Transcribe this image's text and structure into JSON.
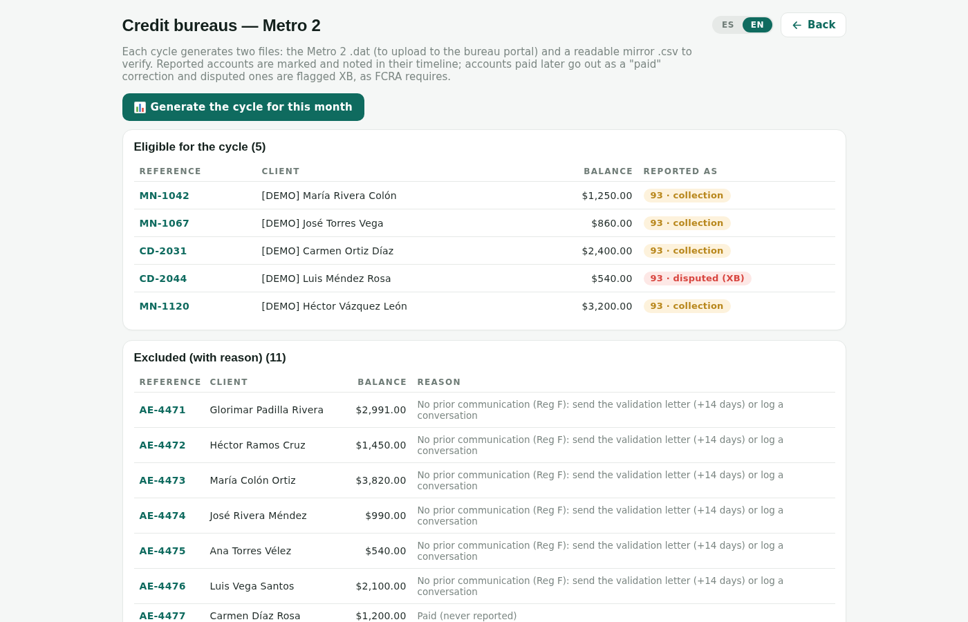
{
  "header": {
    "title": "Credit bureaus — Metro 2",
    "languages": [
      {
        "label": "ES",
        "selected": false
      },
      {
        "label": "EN",
        "selected": true
      }
    ],
    "back_button": {
      "label": "Back"
    }
  },
  "description": "Each cycle generates two files: the Metro 2 .dat (to upload to the bureau portal) and a readable mirror .csv to verify. Reported accounts are marked and noted in their timeline; accounts paid later go out as a \"paid\" correction and disputed ones are flagged XB, as FCRA requires.",
  "generate_button": {
    "label": "Generate the cycle for this month"
  },
  "eligible": {
    "title": "Eligible for the cycle (5)",
    "columns": [
      "REFERENCE",
      "CLIENT",
      "BALANCE",
      "REPORTED AS"
    ],
    "rows": [
      {
        "reference": "MN-1042",
        "client": "[DEMO] María Rivera Colón",
        "balance": "$1,250.00",
        "reported_as": {
          "label": "93 · collection",
          "kind": "collection"
        }
      },
      {
        "reference": "MN-1067",
        "client": "[DEMO] José Torres Vega",
        "balance": "$860.00",
        "reported_as": {
          "label": "93 · collection",
          "kind": "collection"
        }
      },
      {
        "reference": "CD-2031",
        "client": "[DEMO] Carmen Ortiz Díaz",
        "balance": "$2,400.00",
        "reported_as": {
          "label": "93 · collection",
          "kind": "collection"
        }
      },
      {
        "reference": "CD-2044",
        "client": "[DEMO] Luis Méndez Rosa",
        "balance": "$540.00",
        "reported_as": {
          "label": "93 · disputed (XB)",
          "kind": "disputed"
        }
      },
      {
        "reference": "MN-1120",
        "client": "[DEMO] Héctor Vázquez León",
        "balance": "$3,200.00",
        "reported_as": {
          "label": "93 · collection",
          "kind": "collection"
        }
      }
    ]
  },
  "excluded": {
    "title": "Excluded (with reason) (11)",
    "columns": [
      "REFERENCE",
      "CLIENT",
      "BALANCE",
      "REASON"
    ],
    "rows": [
      {
        "reference": "AE-4471",
        "client": "Glorimar Padilla Rivera",
        "balance": "$2,991.00",
        "reason": "No prior communication (Reg F): send the validation letter (+14 days) or log a conversation"
      },
      {
        "reference": "AE-4472",
        "client": "Héctor Ramos Cruz",
        "balance": "$1,450.00",
        "reason": "No prior communication (Reg F): send the validation letter (+14 days) or log a conversation"
      },
      {
        "reference": "AE-4473",
        "client": "María Colón Ortiz",
        "balance": "$3,820.00",
        "reason": "No prior communication (Reg F): send the validation letter (+14 days) or log a conversation"
      },
      {
        "reference": "AE-4474",
        "client": "José Rivera Méndez",
        "balance": "$990.00",
        "reason": "No prior communication (Reg F): send the validation letter (+14 days) or log a conversation"
      },
      {
        "reference": "AE-4475",
        "client": "Ana Torres Vélez",
        "balance": "$540.00",
        "reason": "No prior communication (Reg F): send the validation letter (+14 days) or log a conversation"
      },
      {
        "reference": "AE-4476",
        "client": "Luis Vega Santos",
        "balance": "$2,100.00",
        "reason": "No prior communication (Reg F): send the validation letter (+14 days) or log a conversation"
      },
      {
        "reference": "AE-4477",
        "client": "Carmen Díaz Rosa",
        "balance": "$1,200.00",
        "reason": "Paid (never reported)"
      }
    ]
  }
}
